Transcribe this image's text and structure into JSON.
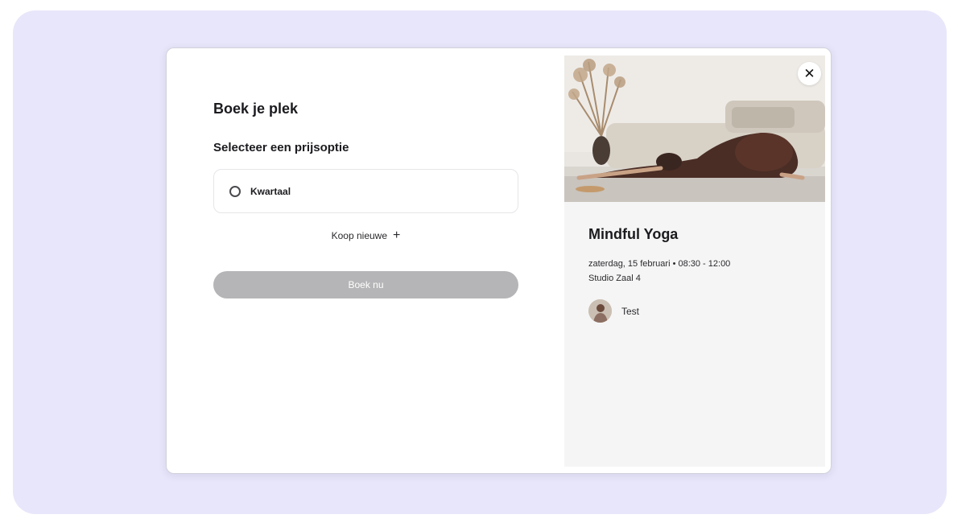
{
  "booking": {
    "title": "Boek je plek",
    "subtitle": "Selecteer een prijsoptie",
    "options": [
      {
        "label": "Kwartaal",
        "selected": false
      }
    ],
    "buy_new_label": "Koop nieuwe",
    "buy_new_icon": "plus-icon",
    "submit_label": "Boek nu",
    "submit_enabled": false
  },
  "class_info": {
    "title": "Mindful Yoga",
    "datetime": "zaterdag, 15 februari • 08:30 - 12:00",
    "location": "Studio Zaal 4",
    "teacher_name": "Test",
    "close_icon": "close-icon"
  },
  "colors": {
    "backdrop": "#e8e6fa",
    "button_disabled": "#b5b5b7",
    "info_panel": "#f5f5f5"
  }
}
